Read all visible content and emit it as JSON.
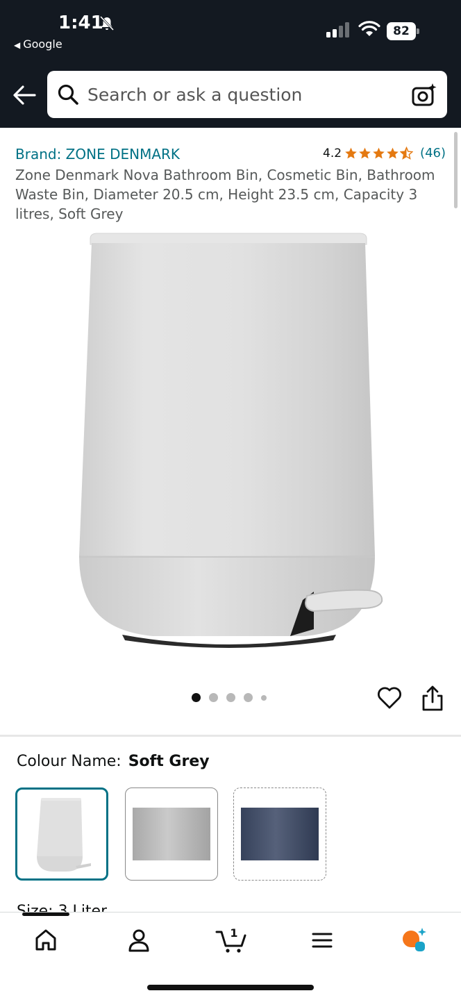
{
  "status_bar": {
    "time": "1:41",
    "back_app": "Google",
    "battery": "82"
  },
  "search": {
    "placeholder": "Search or ask a question"
  },
  "product": {
    "brand": "Brand: ZONE DENMARK",
    "rating_value": "4.2",
    "rating_stars": 4.2,
    "rating_count": "(46)",
    "title": "Zone Denmark Nova Bathroom Bin, Cosmetic Bin, Bathroom Waste Bin, Diameter 20.5 cm, Height 23.5 cm, Capacity 3 litres, Soft Grey"
  },
  "carousel": {
    "total_images": 5,
    "active_index": 0
  },
  "variants": {
    "colour_label": "Colour Name:",
    "colour_value": "Soft Grey",
    "swatches": [
      {
        "name": "Soft Grey",
        "selected": true,
        "available": true
      },
      {
        "name": "Grey",
        "color": "#b5b5b5",
        "selected": false,
        "available": true
      },
      {
        "name": "Navy",
        "color": "#3e4a63",
        "selected": false,
        "available": false
      }
    ],
    "size_peek": "Size: 3 Liter"
  },
  "bottom_nav": {
    "items": [
      "home",
      "account",
      "cart",
      "menu",
      "rufus"
    ],
    "cart_count": "1"
  },
  "colors": {
    "header_bg": "#131921",
    "link": "#007185",
    "star": "#e47911",
    "selected_border": "#007185"
  },
  "icons": [
    "bell-off-icon",
    "signal-icon",
    "wifi-icon",
    "battery-icon",
    "back-arrow-icon",
    "search-icon",
    "camera-icon",
    "star-icon",
    "heart-icon",
    "share-icon",
    "home-icon",
    "account-icon",
    "cart-icon",
    "menu-icon",
    "rufus-icon"
  ]
}
